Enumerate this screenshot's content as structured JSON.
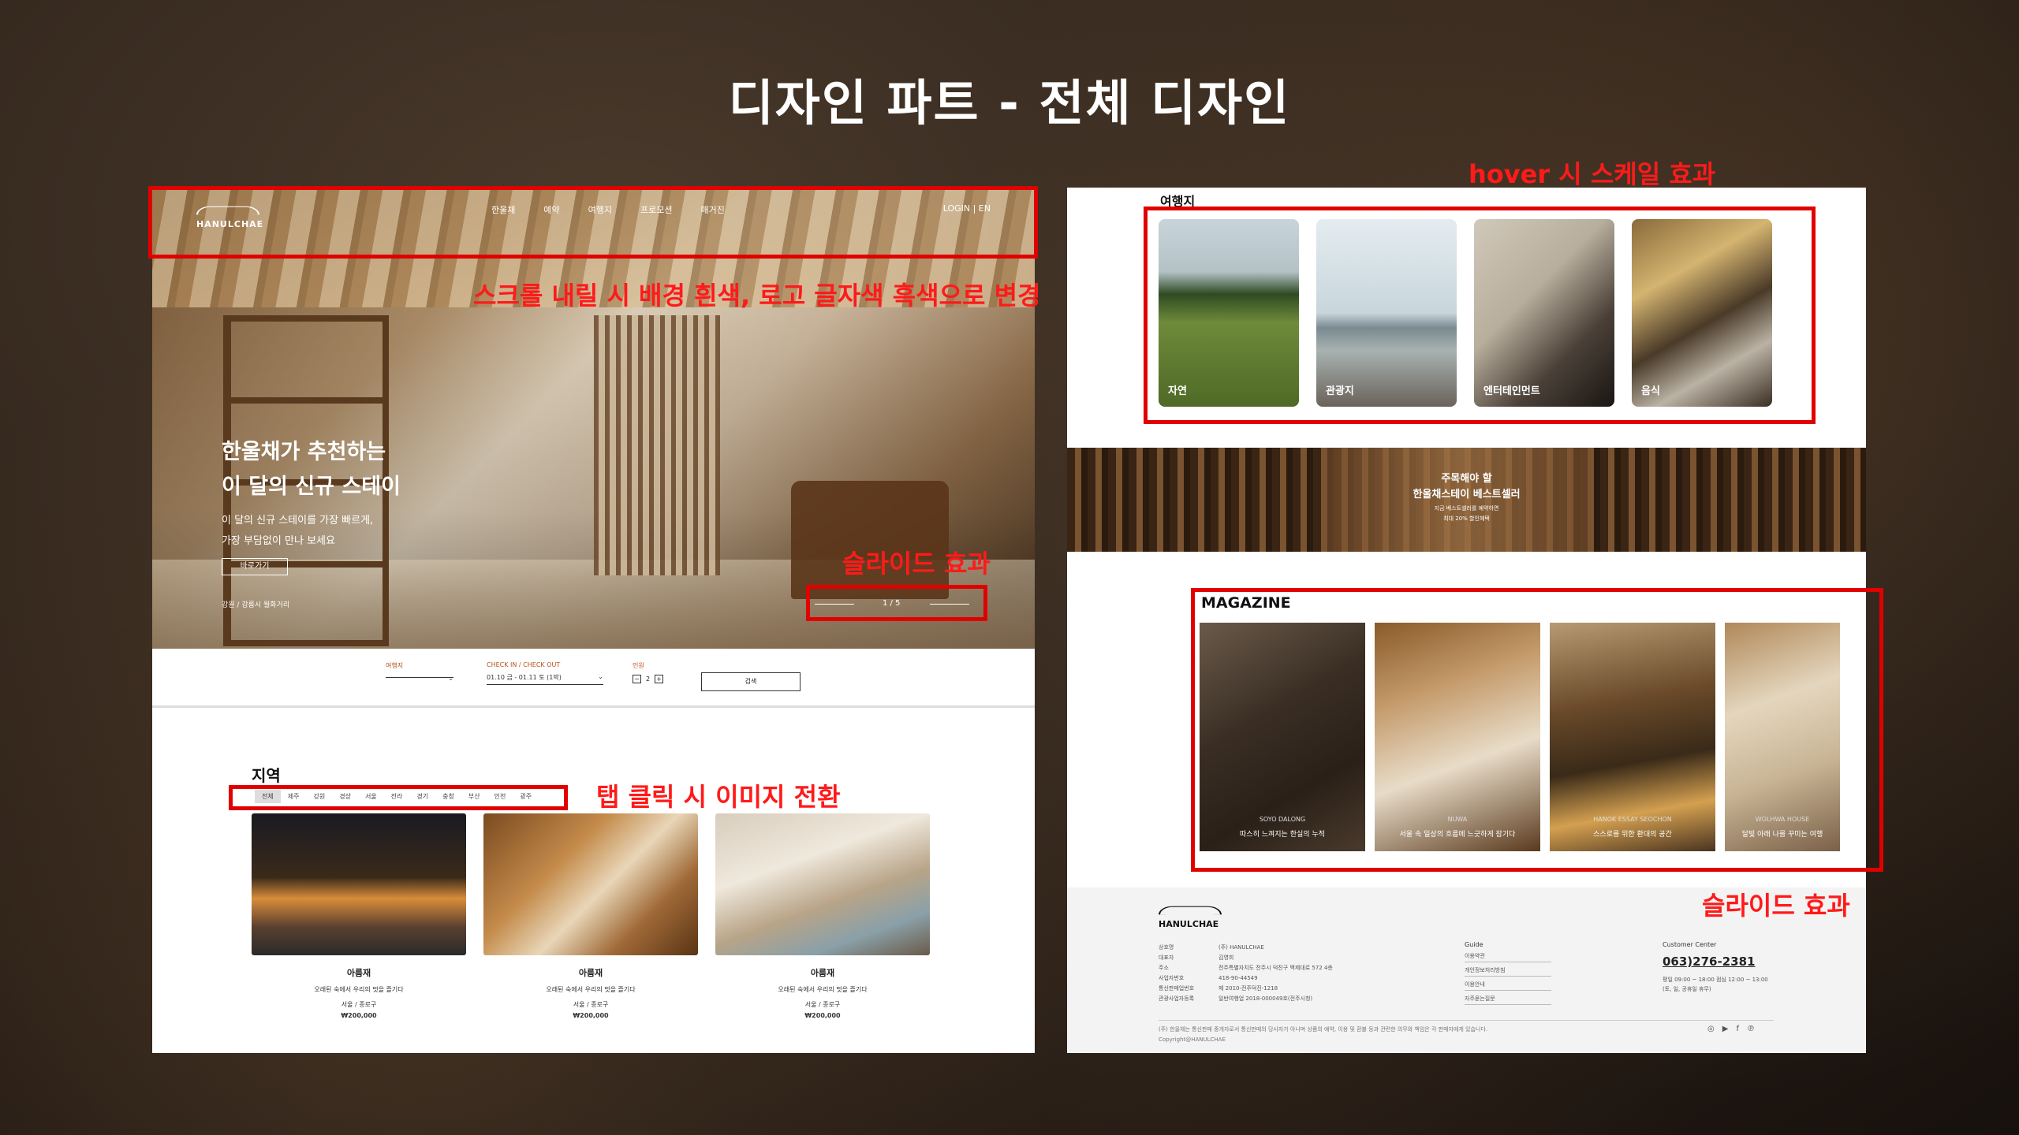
{
  "heading": "디자인 파트 - 전체 디자인",
  "annotations": {
    "scroll": "스크롤 내릴 시 배경 흰색, 로고 글자색 흑색으로 변경",
    "slide_left": "슬라이드 효과",
    "tab": "탭  클릭 시 이미지 전환",
    "hover": "hover 시 스케일 효과",
    "slide_right": "슬라이드 효과"
  },
  "left": {
    "logo": "HANULCHAE",
    "nav": [
      "한울채",
      "예약",
      "여행지",
      "프로모션",
      "매거진"
    ],
    "nav_right": "LOGIN    |    EN",
    "hero_title_1": "한울채가 추천하는",
    "hero_title_2": "이 달의 신규 스테이",
    "hero_sub_1": "이 달의 신규 스테이를 가장 빠르게,",
    "hero_sub_2": "가장 부담없이 만나 보세요",
    "hero_btn": "바로가기",
    "hero_loc": "강원 / 강릉시   월화거리",
    "slider_num": "1 / 5",
    "search": {
      "dest_label": "여행지",
      "dest_value": "",
      "date_label": "CHECK IN / CHECK OUT",
      "date_value": "01.10 금 - 01.11 토 (1박)",
      "guest_label": "인원",
      "guest_value": "2",
      "btn": "검색"
    },
    "region_title": "지역",
    "tabs": [
      "전체",
      "제주",
      "강원",
      "경상",
      "서울",
      "전라",
      "경기",
      "충청",
      "부산",
      "인천",
      "광주"
    ],
    "cards": [
      {
        "name": "아름재",
        "desc": "오래된 숙에서 우리의 멋을 즐기다",
        "loc": "서울 / 종로구",
        "price": "₩200,000"
      },
      {
        "name": "아름재",
        "desc": "오래된 숙에서 우리의 멋을 즐기다",
        "loc": "서울 / 종로구",
        "price": "₩200,000"
      },
      {
        "name": "아름재",
        "desc": "오래된 숙에서 우리의 멋을 즐기다",
        "loc": "서울 / 종로구",
        "price": "₩200,000"
      }
    ]
  },
  "right": {
    "travel_title": "여행지",
    "travel": [
      "자연",
      "관광지",
      "엔터테인먼트",
      "음식"
    ],
    "banner_1": "주목해야 할",
    "banner_2": "한울채스테이 베스트셀러",
    "banner_3": "지금 베스트셀러를 예약하면",
    "banner_4": "최대 20% 할인혜택",
    "mag_title": "MAGAZINE",
    "magazine": [
      {
        "tag": "SOYO DALONG",
        "text": "따스히 느껴지는 한실의 누적"
      },
      {
        "tag": "NUWA",
        "text": "서울 속 일상의 흐름에 느긋하게 잠기다"
      },
      {
        "tag": "HANOK ESSAY SEOCHON",
        "text": "스스로를 위한 환대의 공간"
      },
      {
        "tag": "WOLHWA HOUSE",
        "text": "달빛 아래 나를 꾸미는 여행"
      }
    ],
    "footer": {
      "logo": "HANULCHAE",
      "info_labels": [
        "상호명",
        "대표자",
        "주소",
        "사업자번호",
        "통신판매업번호",
        "관광사업자등록"
      ],
      "info_values": [
        "(주) HANULCHAE",
        "김영희",
        "전주특별자치도 전주시 덕진구 백제대로 572 4층",
        "418-90-44549",
        "제 2010-전주덕진-1218",
        "일반여행업 2018-000049호(전주시청)"
      ],
      "guide_title": "Guide",
      "guide": [
        "이용약관",
        "개인정보처리방침",
        "이용안내",
        "자주묻는질문"
      ],
      "cc_title": "Customer Center",
      "phone": "063)276-2381",
      "hours_1": "평일 09:00 ~ 18:00 점심 12:00 ~ 13:00",
      "hours_2": "(토, 일, 공휴일 휴무)",
      "copy_1": "(주) 한울채는 통신판매 중개자로서 통신판매의 당사자가 아니며 상품의 예약, 이용 및 환불 등과 관련한 의무와 책임은 각 판매자에게 있습니다.",
      "copy_2": "Copyright@HANULCHAE",
      "social": [
        "◎",
        "▶",
        "f",
        "℗"
      ]
    }
  }
}
